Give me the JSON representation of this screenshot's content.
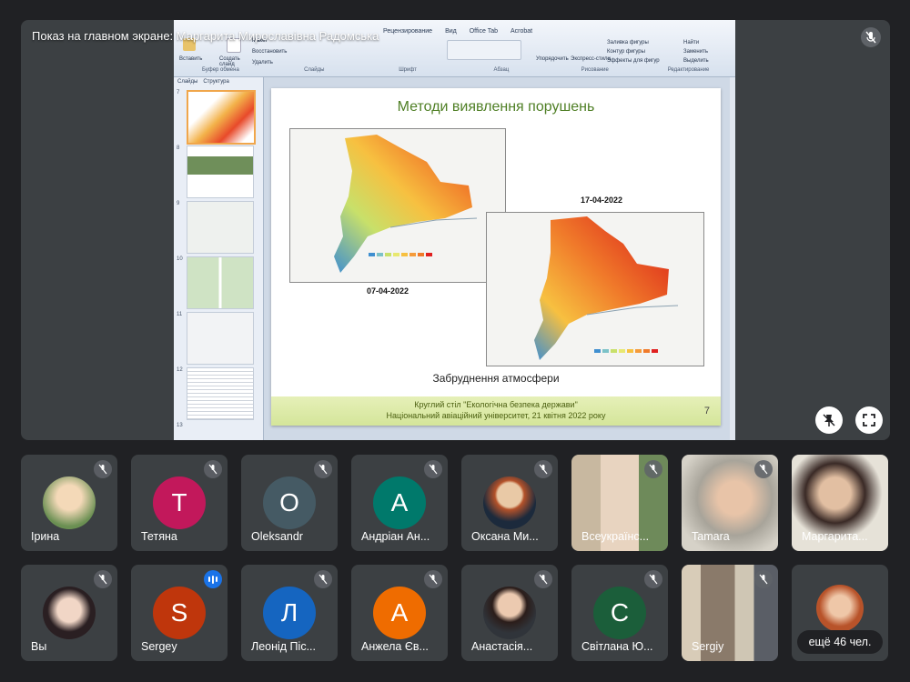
{
  "stage": {
    "caption": "Показ на главном экране: Маргарита Мирославівна Радомська",
    "icons": [
      "mic-off-icon",
      "pin-off-icon",
      "fullscreen-icon"
    ]
  },
  "ppt": {
    "tabs": [
      "Рецензирование",
      "Вид",
      "Office Tab",
      "Acrobat"
    ],
    "buttons": {
      "paste": "Вставить",
      "create_slide": "Создать слайд",
      "layout": "Макет",
      "reset": "Восстановить",
      "delete": "Удалить",
      "arrange": "Упорядочить",
      "quick_styles": "Экспресс-стили",
      "shape_fill": "Заливка фигуры",
      "shape_outline": "Контур фигуры",
      "shape_effects": "Эффекты для фигур",
      "find": "Найти",
      "replace": "Заменить",
      "select": "Выделить"
    },
    "groups": [
      "Буфер обмена",
      "Слайды",
      "Шрифт",
      "Абзац",
      "Рисование",
      "Редактирование"
    ],
    "panel_tabs": [
      "Слайды",
      "Структура"
    ],
    "thumb_numbers": [
      "7",
      "8",
      "9",
      "10",
      "11",
      "12",
      "13"
    ]
  },
  "slide": {
    "title": "Методи виявлення порушень",
    "date_left": "07-04-2022",
    "date_right": "17-04-2022",
    "subtitle": "Забруднення атмосфери",
    "footer_line1": "Круглий стіл \"Екологічна безпека держави\"",
    "footer_line2": "Національний авіаційний університет, 21 квітня 2022 року",
    "number": "7"
  },
  "participants": [
    {
      "name": "Ірина",
      "type": "photo",
      "muted": true
    },
    {
      "name": "Тетяна",
      "type": "initial",
      "initial": "T",
      "color": "#c2185b",
      "muted": true
    },
    {
      "name": "Oleksandr",
      "type": "initial",
      "initial": "O",
      "color": "#455a64",
      "muted": true
    },
    {
      "name": "Андріан Ан...",
      "type": "initial",
      "initial": "A",
      "color": "#00796b",
      "muted": true
    },
    {
      "name": "Оксана Ми...",
      "type": "photo",
      "muted": true
    },
    {
      "name": "Всеукраїнс...",
      "type": "video",
      "muted": true
    },
    {
      "name": "Tamara",
      "type": "video",
      "muted": true
    },
    {
      "name": "Маргарита...",
      "type": "video",
      "muted": false
    },
    {
      "name": "Вы",
      "type": "photo",
      "muted": true
    },
    {
      "name": "Sergey",
      "type": "initial",
      "initial": "S",
      "color": "#bf360c",
      "muted": false,
      "speaking": true
    },
    {
      "name": "Леонід Піс...",
      "type": "initial",
      "initial": "Л",
      "color": "#1565c0",
      "muted": true
    },
    {
      "name": "Анжела Єв...",
      "type": "initial",
      "initial": "A",
      "color": "#ef6c00",
      "muted": true
    },
    {
      "name": "Анастасія...",
      "type": "photo",
      "muted": true
    },
    {
      "name": "Світлана Ю...",
      "type": "initial",
      "initial": "C",
      "color": "#1b5e3a",
      "muted": true
    },
    {
      "name": "Sergiy",
      "type": "video",
      "muted": true
    }
  ],
  "more_label": "ещё 46 чел."
}
